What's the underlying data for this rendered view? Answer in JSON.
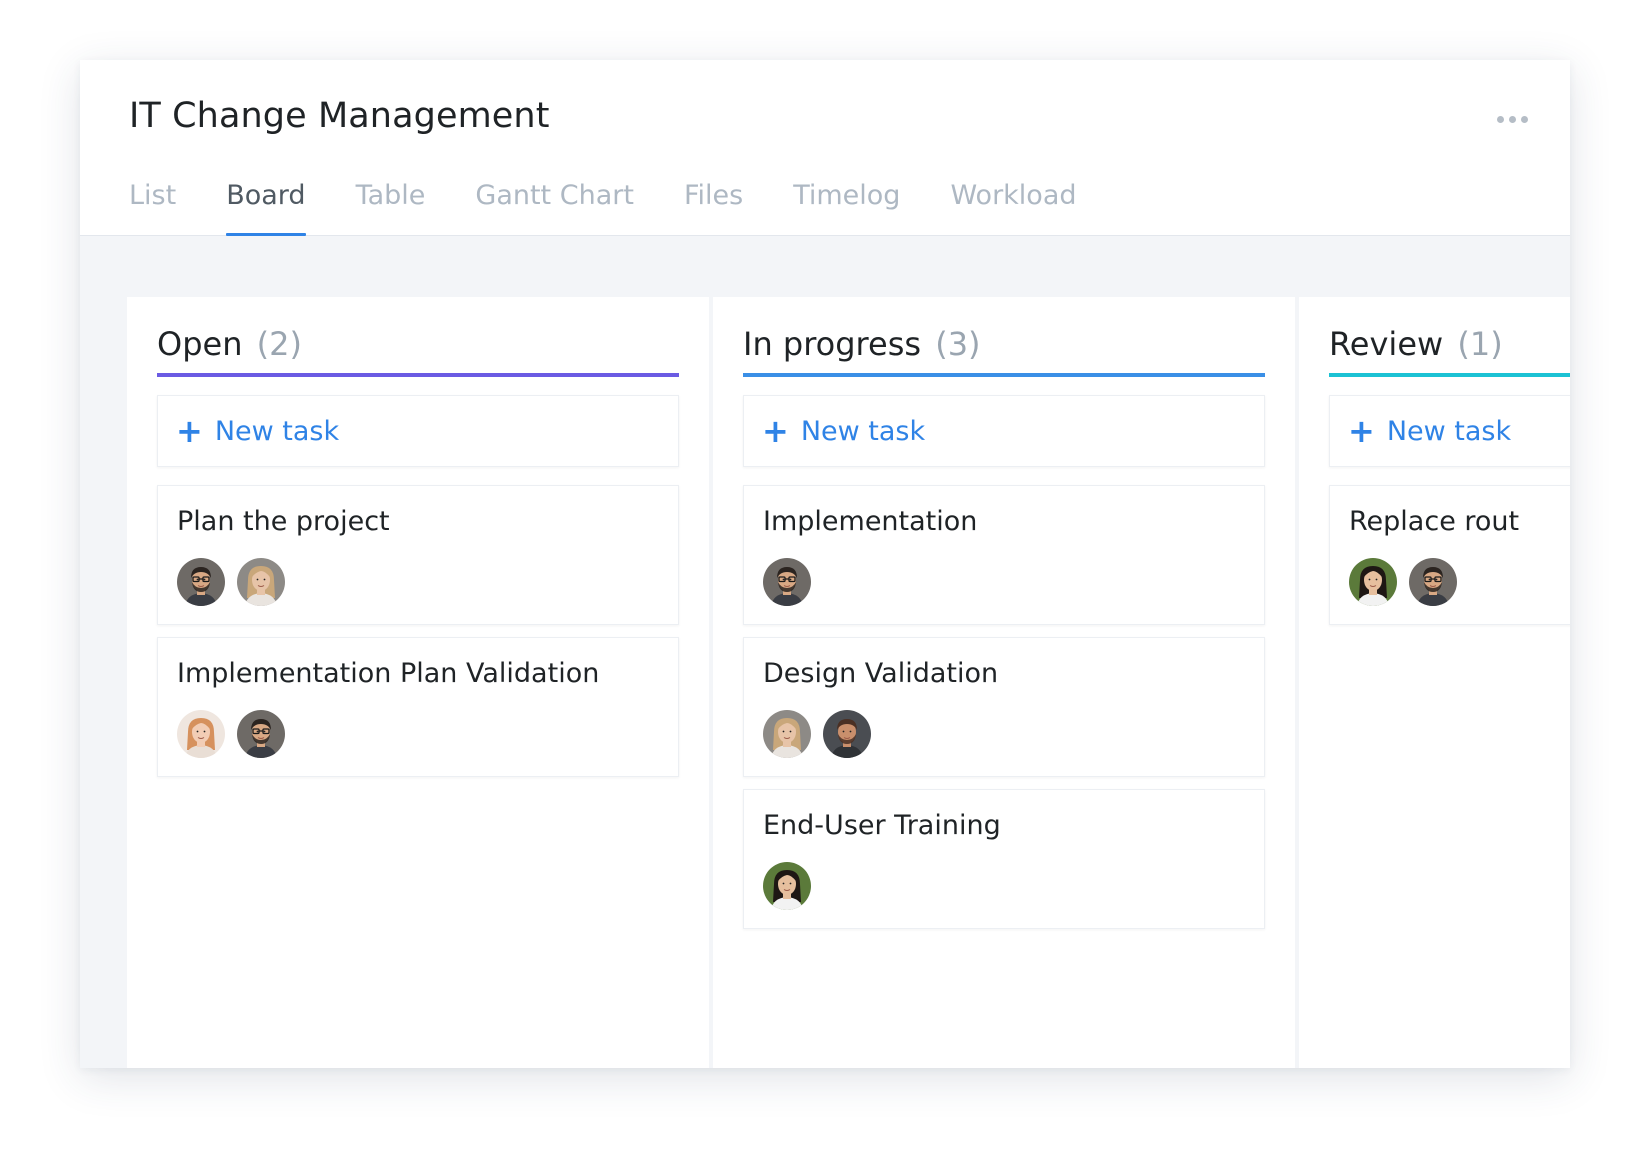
{
  "app": {
    "title": "IT Change Management",
    "more_icon": "more-horizontal-icon"
  },
  "tabs": [
    {
      "label": "List",
      "active": false
    },
    {
      "label": "Board",
      "active": true
    },
    {
      "label": "Table",
      "active": false
    },
    {
      "label": "Gantt Chart",
      "active": false
    },
    {
      "label": "Files",
      "active": false
    },
    {
      "label": "Timelog",
      "active": false
    },
    {
      "label": "Workload",
      "active": false
    }
  ],
  "colors": {
    "accent": "#2f83e6",
    "open": "#6b5be3",
    "in_progress": "#3a8fe6",
    "review": "#1cc2d4"
  },
  "columns": [
    {
      "name": "Open",
      "count": "(2)",
      "new_task_label": "New task",
      "cards": [
        {
          "title": "Plan the project",
          "assignees": [
            "man-glasses",
            "woman-blonde"
          ]
        },
        {
          "title": "Implementation Plan Validation",
          "assignees": [
            "woman-redhead",
            "man-glasses"
          ]
        }
      ]
    },
    {
      "name": "In progress",
      "count": "(3)",
      "new_task_label": "New task",
      "cards": [
        {
          "title": "Implementation",
          "assignees": [
            "man-glasses"
          ]
        },
        {
          "title": "Design Validation",
          "assignees": [
            "woman-blonde",
            "man-beard"
          ]
        },
        {
          "title": "End-User Training",
          "assignees": [
            "woman-asian"
          ]
        }
      ]
    },
    {
      "name": "Review",
      "count": "(1)",
      "new_task_label": "New task",
      "cards": [
        {
          "title": "Replace rout",
          "assignees": [
            "woman-asian",
            "man-glasses"
          ]
        }
      ]
    }
  ]
}
